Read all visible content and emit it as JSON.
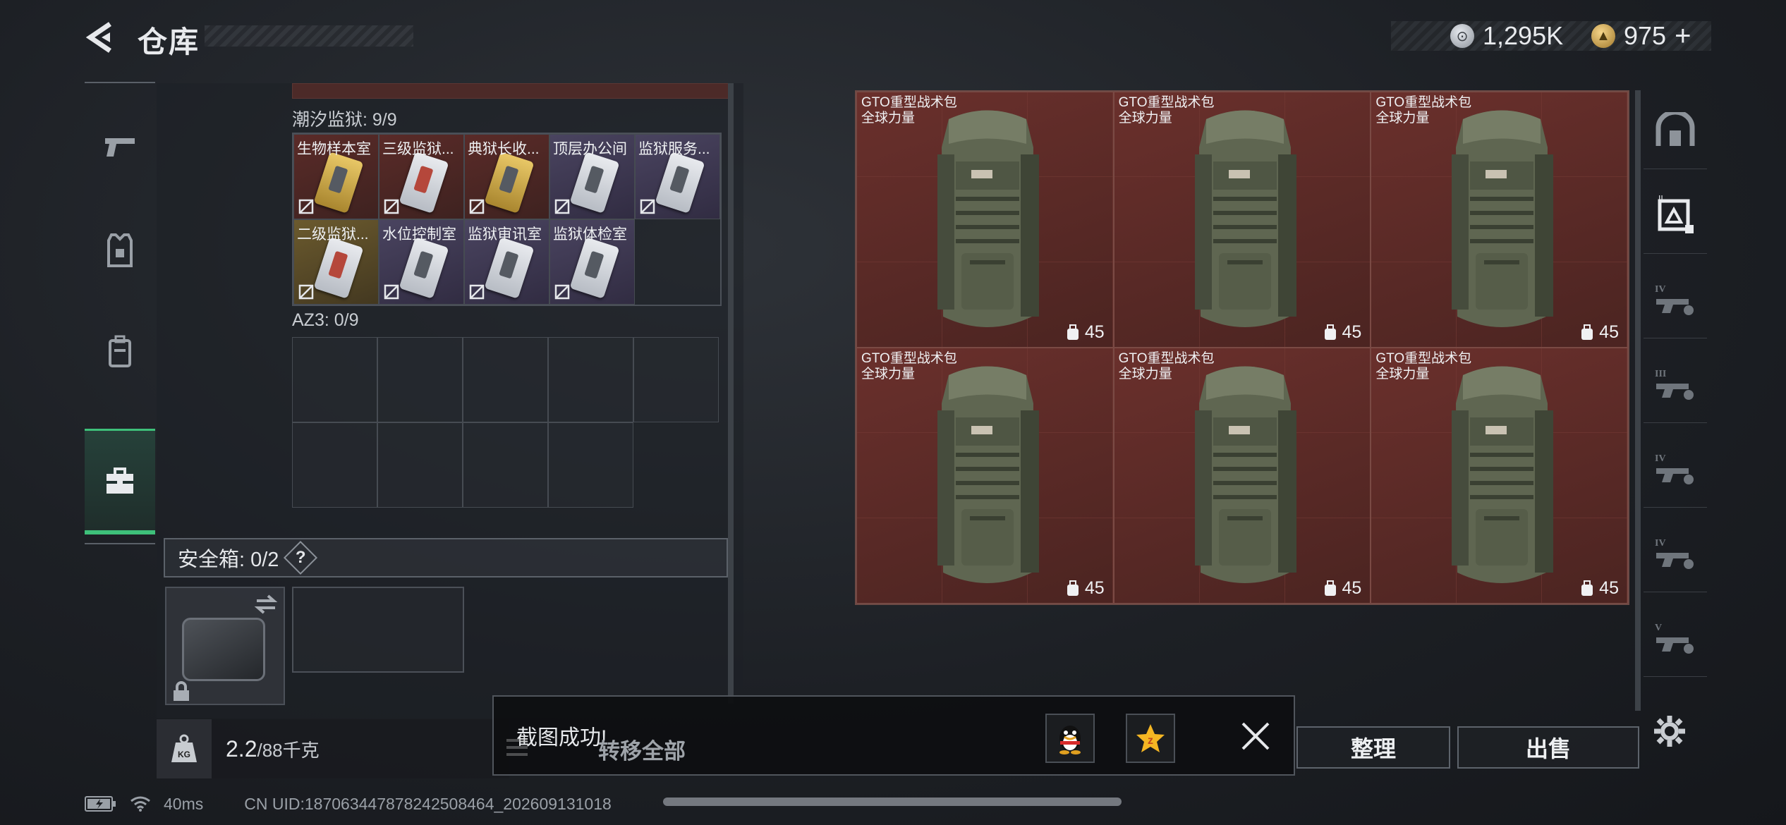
{
  "header": {
    "title": "仓库",
    "currency": [
      {
        "icon": "silver-coin-icon",
        "value": "1,295K"
      },
      {
        "icon": "gold-coin-icon",
        "value": "975"
      }
    ],
    "add_label": "+"
  },
  "sidebar": {
    "items": [
      {
        "icon": "pistol-icon"
      },
      {
        "icon": "armor-vest-icon"
      },
      {
        "icon": "backpack-icon"
      },
      {
        "icon": "toolbox-icon",
        "active": true
      }
    ]
  },
  "keycard_section": {
    "label": "潮汐监狱: 9/9",
    "cards": [
      {
        "name": "生物样本室",
        "color": "red",
        "style": "gold"
      },
      {
        "name": "三级监狱...",
        "color": "red",
        "style": "redmark"
      },
      {
        "name": "典狱长收...",
        "color": "red",
        "style": "gold"
      },
      {
        "name": "顶层办公间",
        "color": "purple",
        "style": "silver"
      },
      {
        "name": "监狱服务...",
        "color": "purple",
        "style": "silver"
      },
      {
        "name": "二级监狱...",
        "color": "gold",
        "style": "redmark"
      },
      {
        "name": "水位控制室",
        "color": "purple",
        "style": "silver"
      },
      {
        "name": "监狱审讯室",
        "color": "purple",
        "style": "silver"
      },
      {
        "name": "监狱体检室",
        "color": "purple",
        "style": "silver"
      }
    ]
  },
  "az3_section": {
    "label": "AZ3: 0/9"
  },
  "safe_box": {
    "label": "安全箱: 0/2",
    "help": "?"
  },
  "weight": {
    "current": "2.2",
    "max": "/88千克",
    "icon_label": "KG"
  },
  "storage": {
    "items": [
      {
        "name": "GTO重型战术包",
        "sub": "全球力量",
        "count": "45"
      },
      {
        "name": "GTO重型战术包",
        "sub": "全球力量",
        "count": "45"
      },
      {
        "name": "GTO重型战术包",
        "sub": "全球力量",
        "count": "45"
      },
      {
        "name": "GTO重型战术包",
        "sub": "全球力量",
        "count": "45"
      },
      {
        "name": "GTO重型战术包",
        "sub": "全球力量",
        "count": "45"
      },
      {
        "name": "GTO重型战术包",
        "sub": "全球力量",
        "count": "45"
      }
    ]
  },
  "right_tabs": [
    {
      "icon": "storage-home-icon",
      "label": ""
    },
    {
      "icon": "crate-tier-icon",
      "label": "II"
    },
    {
      "icon": "weapon-tier-icon",
      "label": "IV"
    },
    {
      "icon": "weapon-tier-icon",
      "label": "III"
    },
    {
      "icon": "weapon-tier-icon",
      "label": "IV"
    },
    {
      "icon": "weapon-tier-icon",
      "label": "IV"
    },
    {
      "icon": "weapon-tier-icon",
      "label": "V"
    }
  ],
  "actions": {
    "transfer_all": "转移全部",
    "organize": "整理",
    "sell": "出售"
  },
  "toast": {
    "message": "截图成功!"
  },
  "status": {
    "ping": "40ms",
    "uid": "CN UID:187063447878242508464_202609131018"
  }
}
